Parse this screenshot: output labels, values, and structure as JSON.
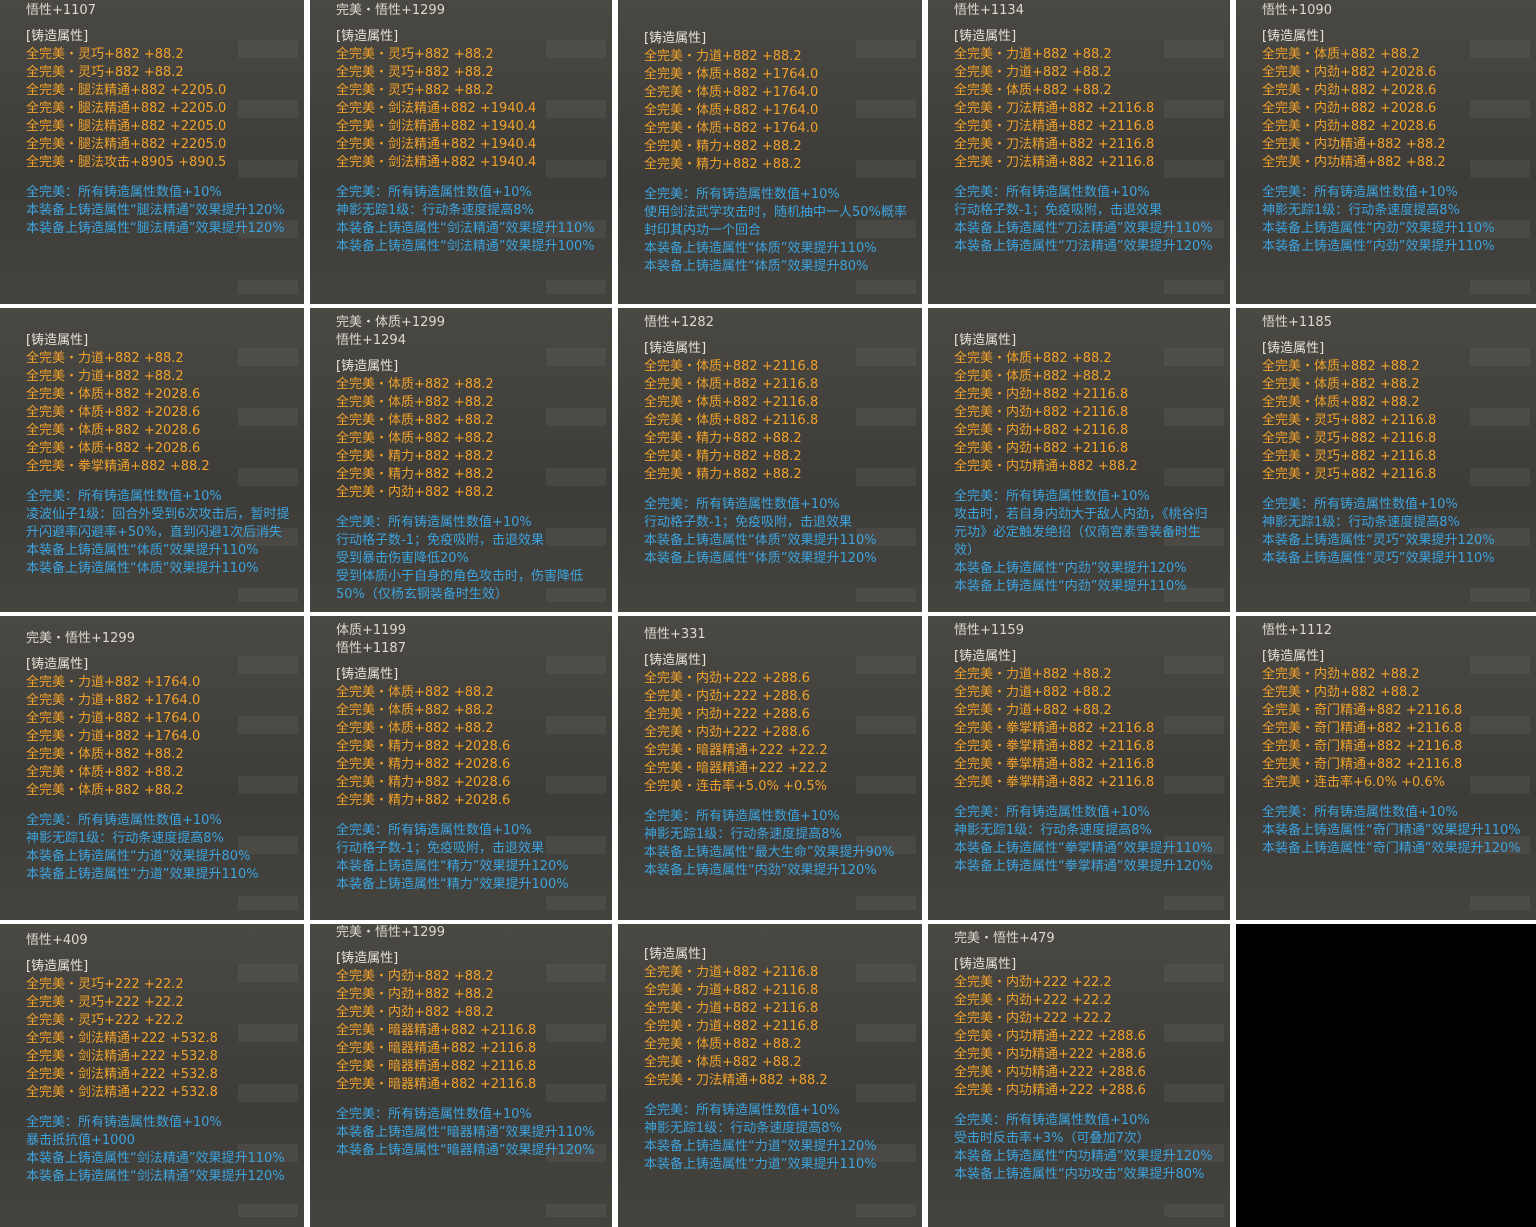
{
  "section_title": "[铸造属性]",
  "cards": [
    {
      "header": [
        "悟性+1107"
      ],
      "attrs": [
        "全完美・灵巧+882 +88.2",
        "全完美・灵巧+882 +88.2",
        "全完美・腿法精通+882 +2205.0",
        "全完美・腿法精通+882 +2205.0",
        "全完美・腿法精通+882 +2205.0",
        "全完美・腿法精通+882 +2205.0",
        "全完美・腿法攻击+8905 +890.5"
      ],
      "effects": [
        "全完美：所有铸造属性数值+10%",
        "本装备上铸造属性“腿法精通”效果提升120%",
        "本装备上铸造属性“腿法精通”效果提升120%"
      ]
    },
    {
      "header": [
        "完美・悟性+1299"
      ],
      "attrs": [
        "全完美・灵巧+882 +88.2",
        "全完美・灵巧+882 +88.2",
        "全完美・灵巧+882 +88.2",
        "全完美・剑法精通+882 +1940.4",
        "全完美・剑法精通+882 +1940.4",
        "全完美・剑法精通+882 +1940.4",
        "全完美・剑法精通+882 +1940.4"
      ],
      "effects": [
        "全完美：所有铸造属性数值+10%",
        "神影无踪1级：行动条速度提高8%",
        "本装备上铸造属性“剑法精通”效果提升110%",
        "本装备上铸造属性“剑法精通”效果提升100%"
      ]
    },
    {
      "header": [],
      "attrs": [
        "全完美・力道+882 +88.2",
        "全完美・体质+882 +1764.0",
        "全完美・体质+882 +1764.0",
        "全完美・体质+882 +1764.0",
        "全完美・体质+882 +1764.0",
        "全完美・精力+882 +88.2",
        "全完美・精力+882 +88.2"
      ],
      "effects": [
        "全完美：所有铸造属性数值+10%",
        "使用剑法武学攻击时，随机抽中一人50%概率封印其内功一个回合",
        "本装备上铸造属性“体质”效果提升110%",
        "本装备上铸造属性“体质”效果提升80%"
      ]
    },
    {
      "header": [
        "悟性+1134"
      ],
      "attrs": [
        "全完美・力道+882 +88.2",
        "全完美・力道+882 +88.2",
        "全完美・体质+882 +88.2",
        "全完美・刀法精通+882 +2116.8",
        "全完美・刀法精通+882 +2116.8",
        "全完美・刀法精通+882 +2116.8",
        "全完美・刀法精通+882 +2116.8"
      ],
      "effects": [
        "全完美：所有铸造属性数值+10%",
        "行动格子数-1；免疫吸附，击退效果",
        "本装备上铸造属性“刀法精通”效果提升110%",
        "本装备上铸造属性“刀法精通”效果提升120%"
      ]
    },
    {
      "header": [
        "悟性+1090"
      ],
      "attrs": [
        "全完美・体质+882 +88.2",
        "全完美・内劲+882 +2028.6",
        "全完美・内劲+882 +2028.6",
        "全完美・内劲+882 +2028.6",
        "全完美・内劲+882 +2028.6",
        "全完美・内功精通+882 +88.2",
        "全完美・内功精通+882 +88.2"
      ],
      "effects": [
        "全完美：所有铸造属性数值+10%",
        "神影无踪1级：行动条速度提高8%",
        "本装备上铸造属性“内劲”效果提升110%",
        "本装备上铸造属性“内劲”效果提升110%"
      ]
    },
    {
      "header": [],
      "attrs": [
        "全完美・力道+882 +88.2",
        "全完美・力道+882 +88.2",
        "全完美・体质+882 +2028.6",
        "全完美・体质+882 +2028.6",
        "全完美・体质+882 +2028.6",
        "全完美・体质+882 +2028.6",
        "全完美・拳掌精通+882 +88.2"
      ],
      "effects": [
        "全完美：所有铸造属性数值+10%",
        "凌波仙子1级：回合外受到6次攻击后，暂时提升闪避率闪避率+50%，直到闪避1次后消失",
        "本装备上铸造属性“体质”效果提升110%",
        "本装备上铸造属性“体质”效果提升110%"
      ]
    },
    {
      "header": [
        "完美・体质+1299",
        "悟性+1294"
      ],
      "attrs": [
        "全完美・体质+882 +88.2",
        "全完美・体质+882 +88.2",
        "全完美・体质+882 +88.2",
        "全完美・体质+882 +88.2",
        "全完美・精力+882 +88.2",
        "全完美・精力+882 +88.2",
        "全完美・内劲+882 +88.2"
      ],
      "effects": [
        "全完美：所有铸造属性数值+10%",
        "行动格子数-1；免疫吸附，击退效果",
        "受到暴击伤害降低20%",
        "受到体质小于自身的角色攻击时，伤害降低50%（仅杨玄钢装备时生效）"
      ]
    },
    {
      "header": [
        "悟性+1282"
      ],
      "attrs": [
        "全完美・体质+882 +2116.8",
        "全完美・体质+882 +2116.8",
        "全完美・体质+882 +2116.8",
        "全完美・体质+882 +2116.8",
        "全完美・精力+882 +88.2",
        "全完美・精力+882 +88.2",
        "全完美・精力+882 +88.2"
      ],
      "effects": [
        "全完美：所有铸造属性数值+10%",
        "行动格子数-1；免疫吸附，击退效果",
        "本装备上铸造属性“体质”效果提升110%",
        "本装备上铸造属性“体质”效果提升120%"
      ]
    },
    {
      "header": [],
      "attrs": [
        "全完美・体质+882 +88.2",
        "全完美・体质+882 +88.2",
        "全完美・内劲+882 +2116.8",
        "全完美・内劲+882 +2116.8",
        "全完美・内劲+882 +2116.8",
        "全完美・内劲+882 +2116.8",
        "全完美・内功精通+882 +88.2"
      ],
      "effects": [
        "全完美：所有铸造属性数值+10%",
        "攻击时，若自身内劲大于敌人内劲，《桃谷归元功》必定触发绝招（仅南宫素雪装备时生效）",
        "本装备上铸造属性“内劲”效果提升120%",
        "本装备上铸造属性“内劲”效果提升110%"
      ]
    },
    {
      "header": [
        "悟性+1185"
      ],
      "attrs": [
        "全完美・体质+882 +88.2",
        "全完美・体质+882 +88.2",
        "全完美・体质+882 +88.2",
        "全完美・灵巧+882 +2116.8",
        "全完美・灵巧+882 +2116.8",
        "全完美・灵巧+882 +2116.8",
        "全完美・灵巧+882 +2116.8"
      ],
      "effects": [
        "全完美：所有铸造属性数值+10%",
        "神影无踪1级：行动条速度提高8%",
        "本装备上铸造属性“灵巧”效果提升120%",
        "本装备上铸造属性“灵巧”效果提升110%"
      ]
    },
    {
      "header": [
        "完美・悟性+1299"
      ],
      "attrs": [
        "全完美・力道+882 +1764.0",
        "全完美・力道+882 +1764.0",
        "全完美・力道+882 +1764.0",
        "全完美・力道+882 +1764.0",
        "全完美・体质+882 +88.2",
        "全完美・体质+882 +88.2",
        "全完美・体质+882 +88.2"
      ],
      "effects": [
        "全完美：所有铸造属性数值+10%",
        "神影无踪1级：行动条速度提高8%",
        "本装备上铸造属性“力道”效果提升80%",
        "本装备上铸造属性“力道”效果提升110%"
      ]
    },
    {
      "header": [
        "体质+1199",
        "悟性+1187"
      ],
      "attrs": [
        "全完美・体质+882 +88.2",
        "全完美・体质+882 +88.2",
        "全完美・体质+882 +88.2",
        "全完美・精力+882 +2028.6",
        "全完美・精力+882 +2028.6",
        "全完美・精力+882 +2028.6",
        "全完美・精力+882 +2028.6"
      ],
      "effects": [
        "全完美：所有铸造属性数值+10%",
        "行动格子数-1；免疫吸附，击退效果",
        "本装备上铸造属性“精力”效果提升120%",
        "本装备上铸造属性“精力”效果提升100%"
      ]
    },
    {
      "header": [
        "悟性+331"
      ],
      "attrs": [
        "全完美・内劲+222 +288.6",
        "全完美・内劲+222 +288.6",
        "全完美・内劲+222 +288.6",
        "全完美・内劲+222 +288.6",
        "全完美・暗器精通+222 +22.2",
        "全完美・暗器精通+222 +22.2",
        "全完美・连击率+5.0% +0.5%"
      ],
      "effects": [
        "全完美：所有铸造属性数值+10%",
        "神影无踪1级：行动条速度提高8%",
        "本装备上铸造属性“最大生命”效果提升90%",
        "本装备上铸造属性“内劲”效果提升120%"
      ]
    },
    {
      "header": [
        "悟性+1159"
      ],
      "attrs": [
        "全完美・力道+882 +88.2",
        "全完美・力道+882 +88.2",
        "全完美・力道+882 +88.2",
        "全完美・拳掌精通+882 +2116.8",
        "全完美・拳掌精通+882 +2116.8",
        "全完美・拳掌精通+882 +2116.8",
        "全完美・拳掌精通+882 +2116.8"
      ],
      "effects": [
        "全完美：所有铸造属性数值+10%",
        "神影无踪1级：行动条速度提高8%",
        "本装备上铸造属性“拳掌精通”效果提升110%",
        "本装备上铸造属性“拳掌精通”效果提升120%"
      ]
    },
    {
      "header": [
        "悟性+1112"
      ],
      "attrs": [
        "全完美・内劲+882 +88.2",
        "全完美・内劲+882 +88.2",
        "全完美・奇门精通+882 +2116.8",
        "全完美・奇门精通+882 +2116.8",
        "全完美・奇门精通+882 +2116.8",
        "全完美・奇门精通+882 +2116.8",
        "全完美・连击率+6.0% +0.6%"
      ],
      "effects": [
        "全完美：所有铸造属性数值+10%",
        "本装备上铸造属性“奇门精通”效果提升110%",
        "本装备上铸造属性“奇门精通”效果提升120%"
      ]
    },
    {
      "header": [
        "悟性+409"
      ],
      "attrs": [
        "全完美・灵巧+222 +22.2",
        "全完美・灵巧+222 +22.2",
        "全完美・灵巧+222 +22.2",
        "全完美・剑法精通+222 +532.8",
        "全完美・剑法精通+222 +532.8",
        "全完美・剑法精通+222 +532.8",
        "全完美・剑法精通+222 +532.8"
      ],
      "effects": [
        "全完美：所有铸造属性数值+10%",
        "暴击抵抗值+1000",
        "本装备上铸造属性“剑法精通”效果提升110%",
        "本装备上铸造属性“剑法精通”效果提升120%"
      ]
    },
    {
      "header": [
        "完美・悟性+1299"
      ],
      "attrs": [
        "全完美・内劲+882 +88.2",
        "全完美・内劲+882 +88.2",
        "全完美・内劲+882 +88.2",
        "全完美・暗器精通+882 +2116.8",
        "全完美・暗器精通+882 +2116.8",
        "全完美・暗器精通+882 +2116.8",
        "全完美・暗器精通+882 +2116.8"
      ],
      "effects": [
        "全完美：所有铸造属性数值+10%",
        "本装备上铸造属性“暗器精通”效果提升110%",
        "本装备上铸造属性“暗器精通”效果提升120%"
      ]
    },
    {
      "header": [],
      "attrs": [
        "全完美・力道+882 +2116.8",
        "全完美・力道+882 +2116.8",
        "全完美・力道+882 +2116.8",
        "全完美・力道+882 +2116.8",
        "全完美・体质+882 +88.2",
        "全完美・体质+882 +88.2",
        "全完美・刀法精通+882 +88.2"
      ],
      "effects": [
        "全完美：所有铸造属性数值+10%",
        "神影无踪1级：行动条速度提高8%",
        "本装备上铸造属性“力道”效果提升120%",
        "本装备上铸造属性“力道”效果提升110%"
      ]
    },
    {
      "header": [
        "完美・悟性+479"
      ],
      "attrs": [
        "全完美・内劲+222 +22.2",
        "全完美・内劲+222 +22.2",
        "全完美・内劲+222 +22.2",
        "全完美・内功精通+222 +288.6",
        "全完美・内功精通+222 +288.6",
        "全完美・内功精通+222 +288.6",
        "全完美・内功精通+222 +288.6"
      ],
      "effects": [
        "全完美：所有铸造属性数值+10%",
        "受击时反击率+3%（可叠加7次）",
        "本装备上铸造属性“内功精通”效果提升120%",
        "本装备上铸造属性“内功攻击”效果提升80%"
      ]
    }
  ]
}
